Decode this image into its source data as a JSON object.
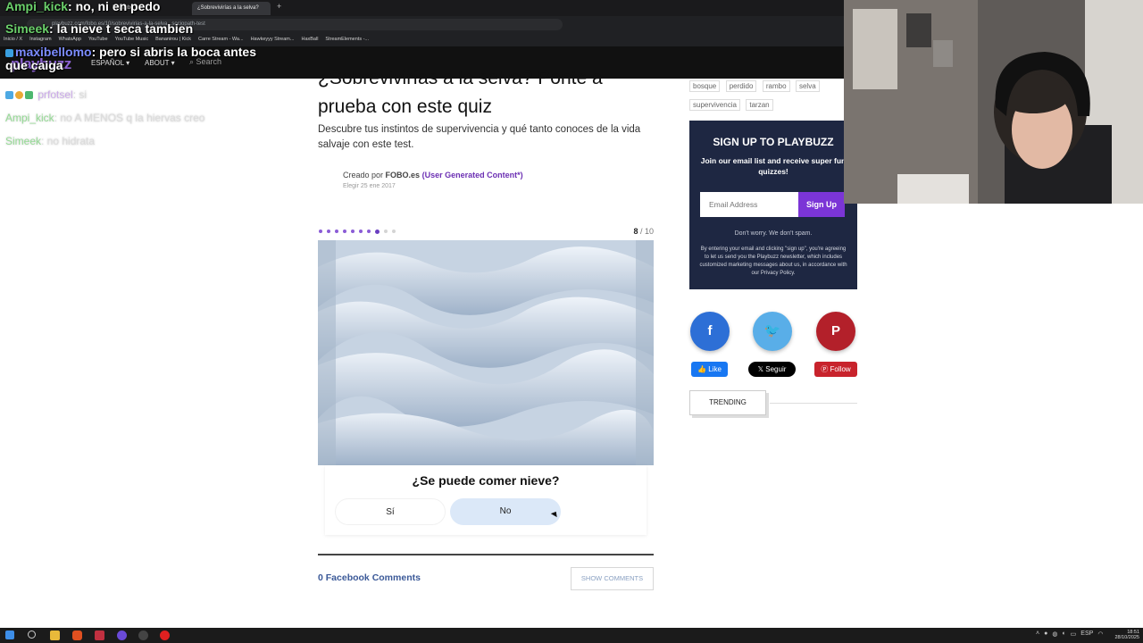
{
  "browser": {
    "tabs": [
      "YouTube",
      "¿Sobrevivirías a la selva?"
    ],
    "new_tab": "+",
    "url": "playbuzz.com/fobo.es/10/sobrevivirias-a-la-selva...sociopath-test",
    "bookmarks": [
      "Inicio / X",
      "Instagram",
      "WhatsApp",
      "YouTube",
      "YouTube Music",
      "Bananirou | Kick",
      "Carre Stream - Wa...",
      "Hawkeyyy Stream...",
      "HaxBall",
      "StreamElements -..."
    ]
  },
  "site": {
    "logo": "playbuzz",
    "nav_language": "ESPAÑOL ▾",
    "nav_about": "ABOUT ▾",
    "nav_search_placeholder": "Search"
  },
  "chat": [
    {
      "user": "Ampi_kick",
      "text": ": no, ni en pedo"
    },
    {
      "user": "Simeek",
      "text": ": la nieve t seca tambien"
    },
    {
      "user": "maxibellomo",
      "text": ": pero si abris la boca antes",
      "text2": "que caiga"
    },
    {
      "user": "prfotsel",
      "text": ": si"
    },
    {
      "user": "Ampi_kick",
      "text": ": no A MENOS q la hiervas creo"
    },
    {
      "user": "Simeek",
      "text": ": no hidrata"
    }
  ],
  "article": {
    "title_line1": "¿Sobrevivirías a la selva? Ponte a",
    "title_line2": "prueba con este quiz",
    "description": "Descubre tus instintos de supervivencia y qué tanto conoces de la vida salvaje con este test.",
    "author_prefix": "Creado por",
    "author": "FOBO.es",
    "author_tag": "(User Generated Content*)",
    "date": "Elegir 25 ene 2017"
  },
  "quiz": {
    "progress": {
      "current": 8,
      "total": 10
    },
    "counter_current": "8",
    "counter_total": " / 10",
    "question": "¿Se puede comer nieve?",
    "answers": [
      "Sí",
      "No"
    ],
    "hovered_answer": "No"
  },
  "comments": {
    "count_label": "0 Facebook Comments",
    "show_button": "SHOW COMMENTS"
  },
  "sidebar": {
    "tags": [
      "bosque",
      "perdido",
      "rambo",
      "selva",
      "supervivencia",
      "tarzan"
    ],
    "signup": {
      "title": "SIGN UP TO PLAYBUZZ",
      "text": "Join our email list and receive super fun quizzes!",
      "input_placeholder": "Email Address",
      "button": "Sign Up",
      "no_spam": "Don't worry. We don't spam.",
      "fine_print": "By entering your email and clicking \"sign up\", you're agreeing to let us send you the Playbuzz newsletter, which includes customized marketing messages about us, in accordance with our Privacy Policy."
    },
    "social": {
      "facebook": "f",
      "twitter": "🐦",
      "pinterest": "P"
    },
    "follow": {
      "like": "👍 Like",
      "x": "𝕏 Seguir",
      "pin": "Ⓟ Follow"
    },
    "trending": "TRENDING"
  },
  "taskbar": {
    "time": "18:51",
    "date": "28/10/2025",
    "lang": "ESP"
  },
  "colors": {
    "accent": "#7b35d6",
    "signup_bg": "#1e2742",
    "facebook": "#2d6fd6",
    "twitter": "#59aee8",
    "pinterest": "#b3202a"
  }
}
